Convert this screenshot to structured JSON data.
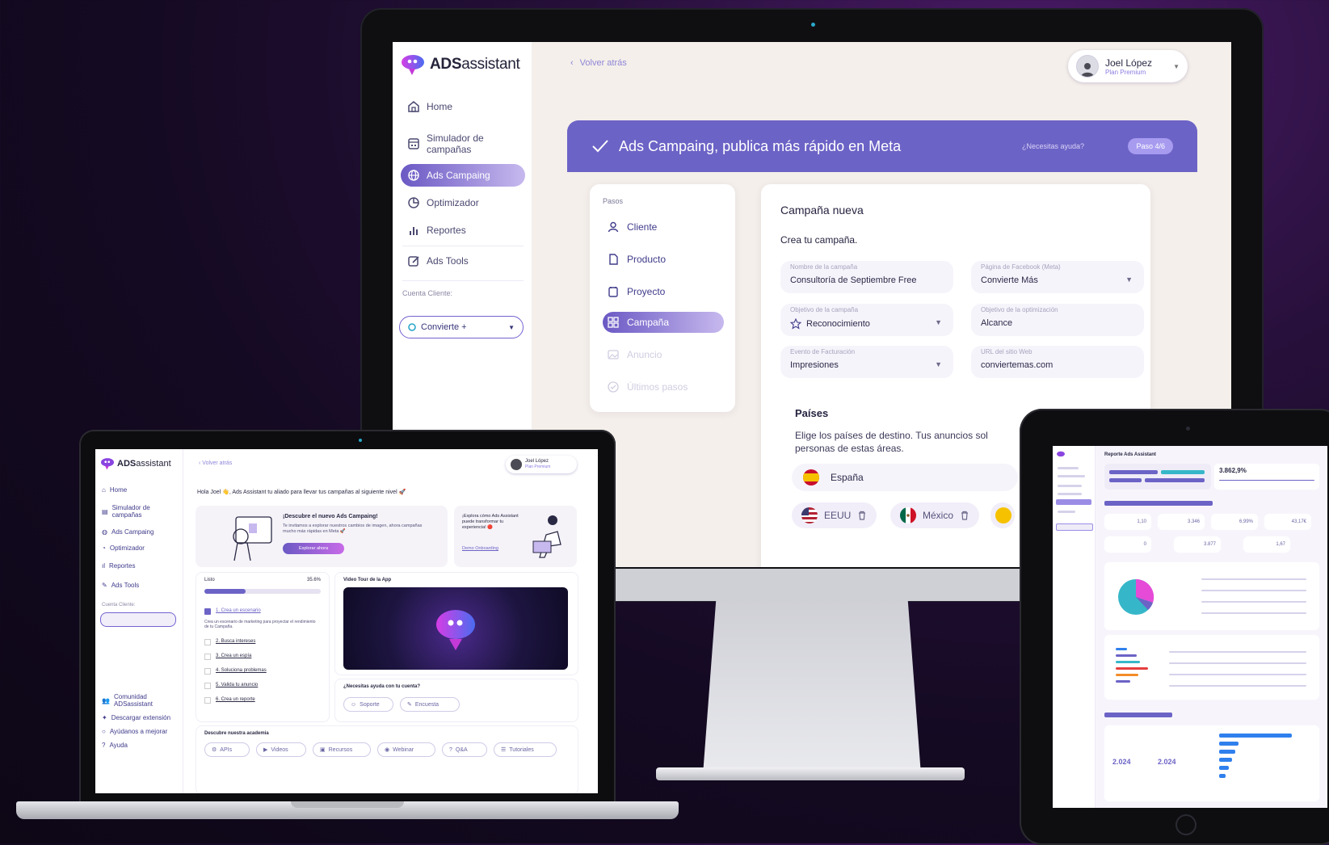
{
  "brand": {
    "name_bold": "ADS",
    "name_rest": "assistant",
    "accent": "#6c63c6",
    "accent_light": "#c7b9ee"
  },
  "desktop": {
    "sidebar": {
      "items": [
        {
          "label": "Home",
          "icon": "home-icon"
        },
        {
          "label": "Simulador de campañas",
          "icon": "calculator-icon"
        },
        {
          "label": "Ads Campaing",
          "icon": "globe-icon",
          "active": true
        },
        {
          "label": "Optimizador",
          "icon": "chart-pie-icon"
        },
        {
          "label": "Reportes",
          "icon": "bar-chart-icon"
        },
        {
          "label": "Ads Tools",
          "icon": "edit-icon"
        }
      ],
      "client_label": "Cuenta Cliente:",
      "client_value": "Convierte +"
    },
    "back_label": "Volver atrás",
    "user": {
      "name": "Joel López",
      "plan": "Plan Premium"
    },
    "banner": {
      "title": "Ads Campaing, publica más rápido en Meta",
      "help": "¿Necesitas ayuda?",
      "step": "Paso 4/6"
    },
    "steps": {
      "title": "Pasos",
      "items": [
        {
          "label": "Cliente",
          "icon": "user-icon",
          "state": "done"
        },
        {
          "label": "Producto",
          "icon": "document-icon",
          "state": "done"
        },
        {
          "label": "Proyecto",
          "icon": "folder-icon",
          "state": "done"
        },
        {
          "label": "Campaña",
          "icon": "grid-icon",
          "state": "active"
        },
        {
          "label": "Anuncio",
          "icon": "image-icon",
          "state": "disabled"
        },
        {
          "label": "Últimos pasos",
          "icon": "check-circle-icon",
          "state": "disabled"
        }
      ]
    },
    "form": {
      "title": "Campaña nueva",
      "subtitle": "Crea tu campaña.",
      "fields": [
        {
          "label": "Nombre de la campaña",
          "value": "Consultoría de Septiembre Free"
        },
        {
          "label": "Página de Facebook (Meta)",
          "value": "Convierte Más"
        },
        {
          "label": "Objetivo de la campaña",
          "value": "Reconocimiento"
        },
        {
          "label": "Objetivo de la optimización",
          "value": "Alcance"
        },
        {
          "label": "Evento de Facturación",
          "value": "Impresiones"
        },
        {
          "label": "URL del sitio Web",
          "value": "conviertemas.com"
        }
      ],
      "countries_title": "Países",
      "countries_desc_1": "Elige los países de destino. Tus anuncios sol",
      "countries_desc_2": "personas de estas áreas.",
      "country_selected": "España",
      "chips": [
        "EEUU",
        "México"
      ]
    }
  },
  "laptop": {
    "back_label": "Volver atrás",
    "user": {
      "name": "Joel López",
      "plan": "Plan Premium"
    },
    "nav": [
      "Home",
      "Simulador de campañas",
      "Ads Campaing",
      "Optimizador",
      "Reportes",
      "Ads Tools"
    ],
    "client_label": "Cuenta Cliente:",
    "bottom_links": [
      "Comunidad ADSassistant",
      "Descargar extensión",
      "Ayúdanos a mejorar",
      "Ayuda"
    ],
    "greeting": "Hola Joel 👋, Ads Assistant tu aliado para llevar tus campañas al siguiente nivel 🚀",
    "promo_title": "¡Descubre el nuevo Ads Campaing!",
    "promo_text": "Te invitamos a explorar nuestros cambios de imagen, ahora campañas mucho más rápidas en Meta 🚀",
    "promo_button": "Explorar ahora",
    "explore_text": "¡Explora cómo Ads Assistant puede transformar tu experiencia! 🔴",
    "explore_link": "Demo Onboarding",
    "progress_label": "Listo",
    "progress_value": "35.6%",
    "progress_fraction": 0.356,
    "tasks": [
      "1. Crea un escenario",
      "2. Busca intereses",
      "3. Crea un espía",
      "4. Soluciona problemas",
      "5. Valida tu anuncio",
      "6. Crea un reporte"
    ],
    "task_desc": "Crea un escenario de marketing para proyectar el rendimiento de tu Campaña.",
    "video_title": "Video Tour de la App",
    "help_title": "¿Necesitas ayuda con tu cuenta?",
    "help_buttons": [
      "Soporte",
      "Encuesta"
    ],
    "academy_title": "Descubre nuestra academia",
    "academy_tags": [
      "APIs",
      "Videos",
      "Recursos",
      "Webinar",
      "Q&A",
      "Tutoriales"
    ]
  },
  "tablet": {
    "report_title": "Reporte Ads Assistant",
    "big_number": "3.862,9%",
    "kpis": [
      "1,10",
      "3.346",
      "6,99%",
      "43,17€",
      "0",
      "3.877",
      "1,67"
    ],
    "footer_numbers": [
      "2.024",
      "2.024"
    ],
    "pie_colors": [
      "#e64bd8",
      "#36b7c9",
      "#6c63c6"
    ],
    "bar_colors": [
      "#e53e3e",
      "#f28c28",
      "#6c63c6",
      "#36b7c9",
      "#2f80ed"
    ]
  }
}
